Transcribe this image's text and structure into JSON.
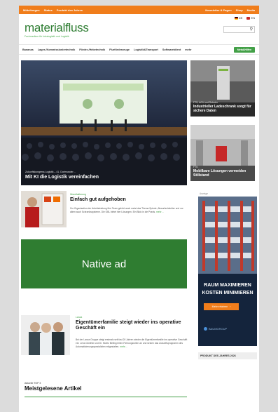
{
  "topbar": {
    "left": [
      "Mitteilungen",
      "Status",
      "Produkt des Jahres"
    ],
    "right": [
      "Newsletter & Pagen",
      "Shop",
      "Media"
    ]
  },
  "lang": {
    "de": "DE",
    "en": "EN"
  },
  "logo": "materialfluss",
  "tagline": "Fachmedium für Intralogistik und Logistik",
  "nav": {
    "items": [
      "Bananas",
      "Lager-/Kommissioniertechnik",
      "Förder-/Hebetechnik",
      "Flurförderzeuge",
      "Logistik&Transport",
      "Softwaretdient",
      "mehr"
    ],
    "cta": "Meta&Hilfen"
  },
  "hero": {
    "kicker": "Zukunftskongress Logistik – 41. Dortmunder…",
    "title": "Mit KI die Logistik vereinfachen"
  },
  "side1": {
    "kicker": "FTS, AGV und Roboter",
    "title": "Industrieller Ladeschrank sorgt für sichere Daten"
  },
  "side2": {
    "kicker": "FTS",
    "title": "Mobilbare Lösungen vermeiden Stillstand"
  },
  "article1": {
    "kicker": "Wandhalterung",
    "title": "Einfach gut aufgehoben",
    "body": "Zur Organisation der Arbeitsleistung füm Team gehört auch meist das Thema Spinde, Abwurfschächter und vor allem auch Schrankssysteme. Die OBL bietet hier Lösungen. Ein Blick in die Praxis.",
    "more": "mehr…"
  },
  "native_ad": "Native ad",
  "article2": {
    "kicker": "Lanza",
    "title": "Eigentümerfamilie steigt wieder ins operative Geschäft ein",
    "body": "Bei der Lanza Gruppe steigt erstmals seit fast 20 Jahren wieder die Eigentümerfamilie ins operative Geschäft ein: Lena Günther und Dr. Moritz Belling leiten Führungsrollen an und setzen das Zukunftsprogramm des Automatisierungsspezialisten mitgestalten.",
    "more": "mehr…"
  },
  "ad": {
    "label": "Anzeige",
    "headline": [
      "RAUM MAXIMIEREN",
      "KOSTEN MINIMIEREN"
    ],
    "button": "Mehr erfahren",
    "brand": "BAUMGROUP"
  },
  "product_year": "PRODUKT DES JAHRES 2026",
  "top3": {
    "kicker": "Aktuelle TOP 3",
    "title": "Meistgelesene Artikel"
  },
  "colors": {
    "brand_green": "#2e7d32",
    "accent_orange": "#f07d1b",
    "native_green": "#2f7d31"
  }
}
